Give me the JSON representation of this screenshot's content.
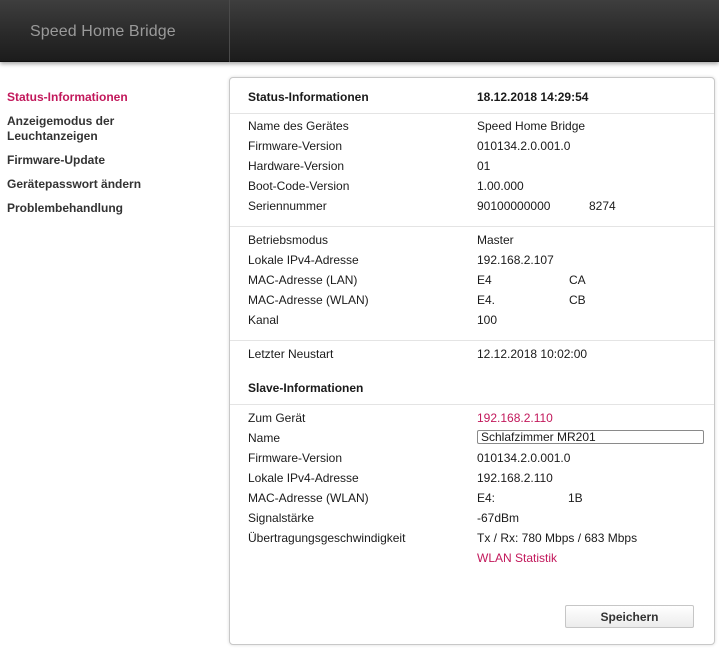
{
  "header": {
    "title": "Speed Home Bridge"
  },
  "sidebar": {
    "items": [
      {
        "label": "Status-Informationen"
      },
      {
        "label": "Anzeigemodus der Leuchtanzeigen"
      },
      {
        "label": "Firmware-Update"
      },
      {
        "label": "Gerätepasswort ändern"
      },
      {
        "label": "Problembehandlung"
      }
    ]
  },
  "status": {
    "title": "Status-Informationen",
    "datetime": "18.12.2018 14:29:54",
    "device_name_label": "Name des Gerätes",
    "device_name_value": "Speed Home Bridge",
    "firmware_label": "Firmware-Version",
    "firmware_value": "010134.2.0.001.0",
    "hardware_label": "Hardware-Version",
    "hardware_value": "01",
    "bootcode_label": "Boot-Code-Version",
    "bootcode_value": "1.00.000",
    "serial_label": "Seriennummer",
    "serial_value_a": "90100000000",
    "serial_value_b": "8274",
    "mode_label": "Betriebsmodus",
    "mode_value": "Master",
    "ipv4_label": "Lokale IPv4-Adresse",
    "ipv4_value": "192.168.2.107",
    "mac_lan_label": "MAC-Adresse (LAN)",
    "mac_lan_a": "E4",
    "mac_lan_b": "CA",
    "mac_wlan_label": "MAC-Adresse (WLAN)",
    "mac_wlan_a": "E4.",
    "mac_wlan_b": "CB",
    "channel_label": "Kanal",
    "channel_value": "100",
    "restart_label": "Letzter Neustart",
    "restart_value": "12.12.2018 10:02:00"
  },
  "slave": {
    "title": "Slave-Informationen",
    "device_label": "Zum Gerät",
    "device_link": "192.168.2.110",
    "name_label": "Name",
    "name_value": "Schlafzimmer MR201",
    "firmware_label": "Firmware-Version",
    "firmware_value": "010134.2.0.001.0",
    "ipv4_label": "Lokale IPv4-Adresse",
    "ipv4_value": "192.168.2.110",
    "mac_wlan_label": "MAC-Adresse (WLAN)",
    "mac_wlan_a": "E4:",
    "mac_wlan_b": "1B",
    "signal_label": "Signalstärke",
    "signal_value": "-67dBm",
    "speed_label": "Übertragungsgeschwindigkeit",
    "speed_value": "Tx / Rx: 780 Mbps / 683 Mbps",
    "wlan_stats_link": "WLAN Statistik"
  },
  "actions": {
    "save_label": "Speichern"
  }
}
